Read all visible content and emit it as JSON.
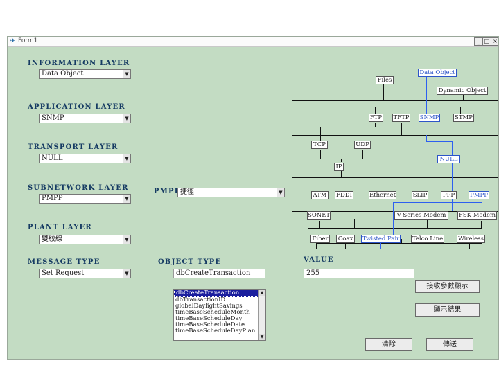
{
  "window": {
    "title": "Form1",
    "controls": [
      "_",
      "□",
      "×"
    ]
  },
  "form": {
    "information_layer": {
      "label": "INFORMATION LAYER",
      "value": "Data Object"
    },
    "application_layer": {
      "label": "APPLICATION LAYER",
      "value": "SNMP"
    },
    "transport_layer": {
      "label": "TRANSPORT LAYER",
      "value": "NULL"
    },
    "subnetwork_layer": {
      "label": "SUBNETWORK LAYER",
      "value": "PMPP"
    },
    "pmpp": {
      "label": "PMPP",
      "value": "捷徑"
    },
    "plant_layer": {
      "label": "PLANT LAYER",
      "value": "雙絞線"
    },
    "message_type": {
      "label": "MESSAGE TYPE",
      "value": "Set Request"
    },
    "object_type": {
      "label": "OBJECT TYPE",
      "value": "dbCreateTransaction",
      "list": [
        "dbCreateTransaction",
        "dbTransactionID",
        "globalDaylightSavings",
        "timeBaseScheduleMonth",
        "timeBaseScheduleDay",
        "timeBaseScheduleDate",
        "timeBaseScheduleDayPlan"
      ]
    },
    "value_field": {
      "label": "VALUE",
      "value": "255"
    },
    "buttons": {
      "wait_ack": "接收參數顯示",
      "show_result": "顯示結果",
      "clear": "清除",
      "send": "傳送"
    }
  },
  "diagram": {
    "row1": {
      "files": "Files",
      "data_object": "Data Object",
      "dynamic_object": "Dynamic Object"
    },
    "row2": {
      "ftp": "FTP",
      "tftp": "TFTP",
      "snmp": "SNMP",
      "stmp": "STMP"
    },
    "row3": {
      "tcp": "TCP",
      "udp": "UDP",
      "null": "NULL"
    },
    "row4": {
      "ip": "IP"
    },
    "row5": {
      "atm": "ATM",
      "fddi": "FDDI",
      "ethernet": "Ethernet",
      "slip": "SLIP",
      "ppp": "PPP",
      "pmpp": "PMPP"
    },
    "row6": {
      "sonet": "SONET",
      "v_series_modem": "V Series Modem",
      "fsk_modem": "FSK Modem"
    },
    "row7": {
      "fiber": "Fiber",
      "coax": "Coax",
      "twisted_pair": "Twisted Pair",
      "telco_line": "Telco Line",
      "wireless": "Wireless"
    }
  },
  "colors": {
    "background": "#c3dcc3",
    "label": "#163b63",
    "highlight": "#2d5ff0",
    "selection": "#1b1f9e"
  },
  "icons": [
    "app-icon",
    "dropdown-arrow-icon",
    "scroll-up-icon",
    "scroll-down-icon"
  ]
}
